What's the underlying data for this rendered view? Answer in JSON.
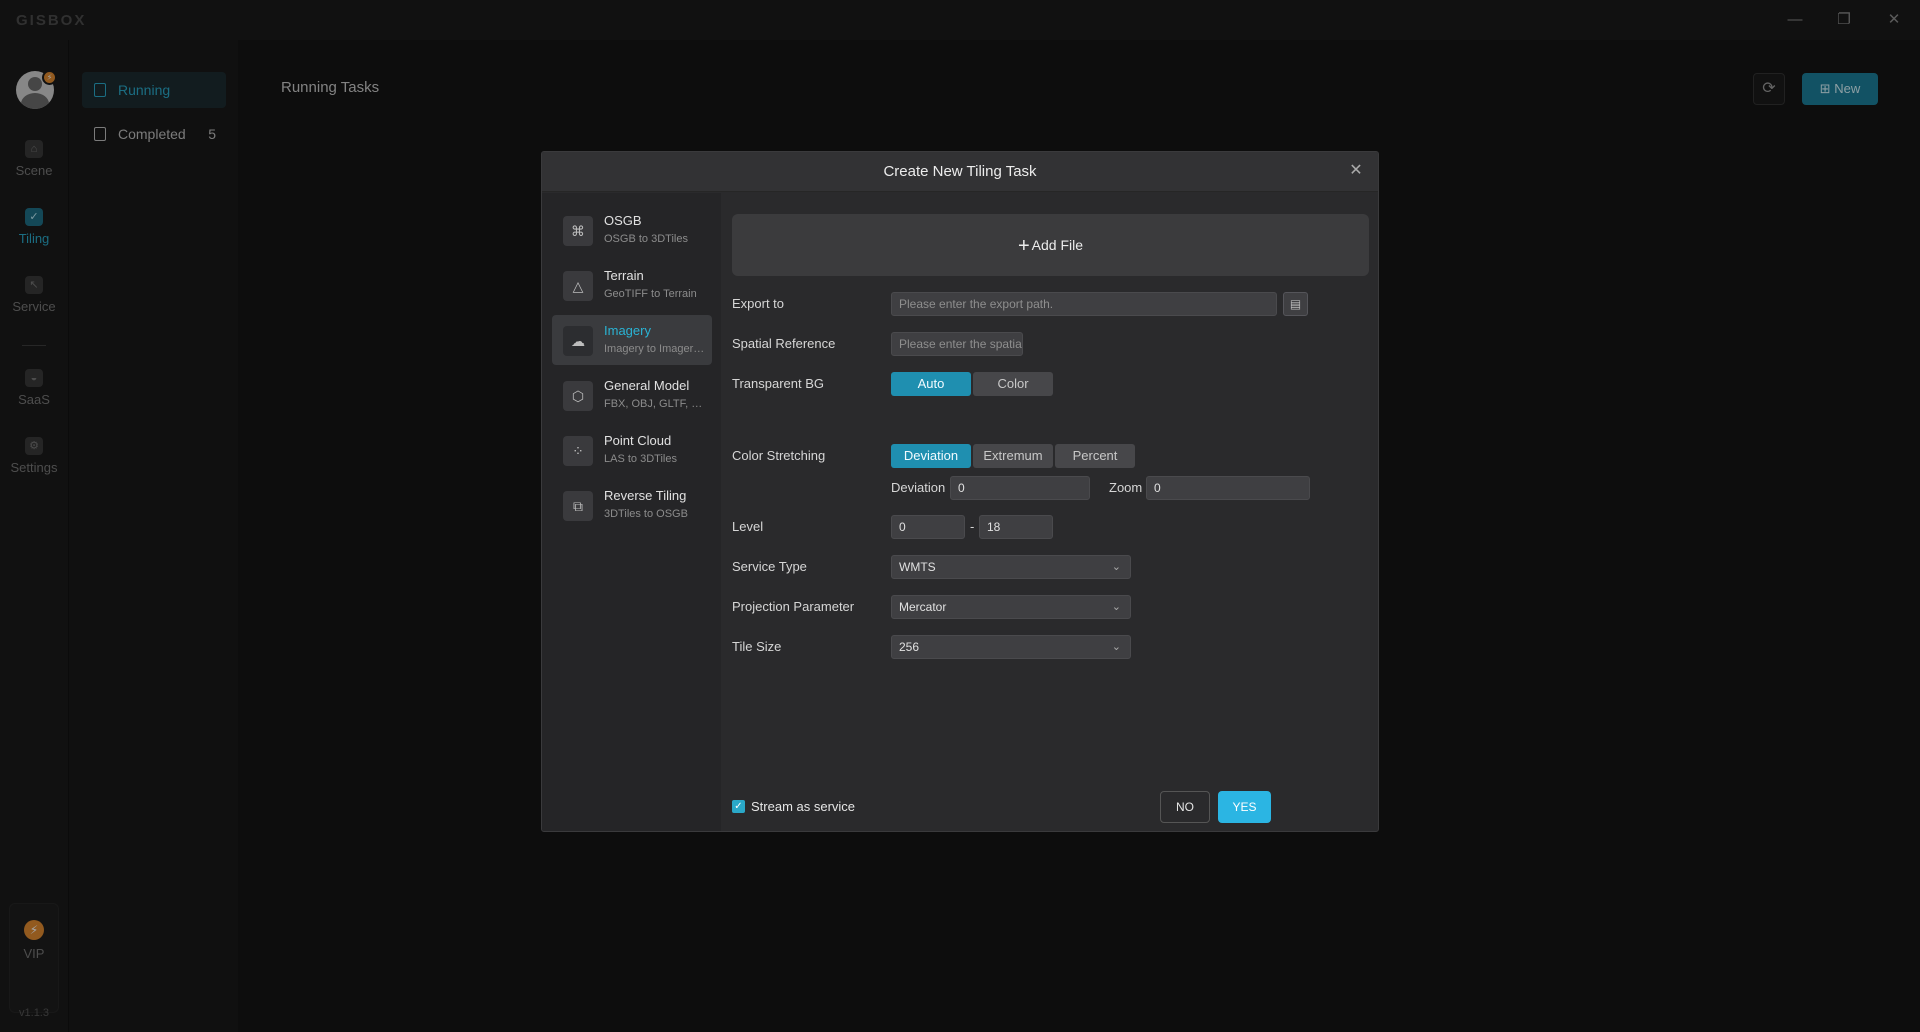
{
  "app": {
    "logo": "GISBOX",
    "window_controls": [
      "—",
      "❐",
      "✕"
    ],
    "version": "v1.1.3"
  },
  "rail": {
    "items": [
      {
        "label": "Scene",
        "icon": "scene-icon",
        "glyph": "⌂"
      },
      {
        "label": "Tiling",
        "icon": "tiling-icon",
        "glyph": "✓",
        "active": true
      },
      {
        "label": "Service",
        "icon": "service-icon",
        "glyph": "↖"
      },
      {
        "label": "SaaS",
        "icon": "saas-icon",
        "glyph": "◒"
      },
      {
        "label": "Settings",
        "icon": "settings-icon",
        "glyph": "⚙"
      }
    ],
    "vip": {
      "label": "VIP",
      "glyph": "⚡"
    },
    "avatar_badge": "⚡"
  },
  "tasks": {
    "items": [
      {
        "label": "Running",
        "active": true,
        "count": ""
      },
      {
        "label": "Completed",
        "count": "5"
      }
    ]
  },
  "main": {
    "title": "Running Tasks",
    "refresh_glyph": "⟳",
    "new_label": "New",
    "new_glyph": "⊞"
  },
  "modal": {
    "title": "Create New Tiling Task",
    "close_glyph": "✕",
    "types": [
      {
        "name": "OSGB",
        "sub": "OSGB to 3DTiles",
        "glyph": "⌘"
      },
      {
        "name": "Terrain",
        "sub": "GeoTIFF to Terrain",
        "glyph": "△"
      },
      {
        "name": "Imagery",
        "sub": "Imagery to Imagery Tiles",
        "glyph": "☁",
        "active": true
      },
      {
        "name": "General Model",
        "sub": "FBX, OBJ, GLTF, GLB",
        "glyph": "⬡"
      },
      {
        "name": "Point Cloud",
        "sub": "LAS to 3DTiles",
        "glyph": "⁘"
      },
      {
        "name": "Reverse Tiling",
        "sub": "3DTiles to OSGB",
        "glyph": "⧉"
      }
    ],
    "add_file": "Add File",
    "form": {
      "export_label": "Export to",
      "export_placeholder": "Please enter the export path.",
      "spatial_label": "Spatial Reference",
      "spatial_placeholder": "Please enter the spatia",
      "transparent_label": "Transparent BG",
      "transparent_options": [
        "Auto",
        "Color"
      ],
      "transparent_selected": "Auto",
      "stretch_label": "Color Stretching",
      "stretch_options": [
        "Deviation",
        "Extremum",
        "Percent"
      ],
      "stretch_selected": "Deviation",
      "deviation_label": "Deviation",
      "deviation_value": "0",
      "zoom_label": "Zoom",
      "zoom_value": "0",
      "level_label": "Level",
      "level_min": "0",
      "level_sep": "-",
      "level_max": "18",
      "service_type_label": "Service Type",
      "service_type_value": "WMTS",
      "projection_label": "Projection Parameter",
      "projection_value": "Mercator",
      "tile_size_label": "Tile Size",
      "tile_size_value": "256"
    },
    "stream_label": "Stream as service",
    "stream_checked": true,
    "no_label": "NO",
    "yes_label": "YES"
  },
  "colors": {
    "accent": "#2aa8c8",
    "primary_button": "#2bb5e3",
    "vip": "#e08a30"
  }
}
